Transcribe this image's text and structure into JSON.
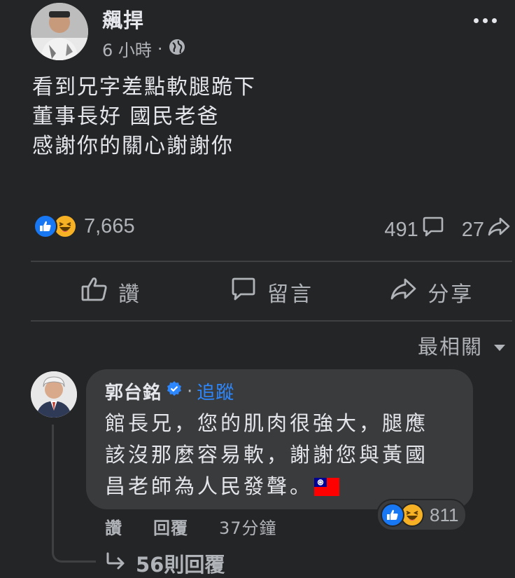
{
  "post": {
    "author": "飆捍",
    "time": "6 小時",
    "separator": "·",
    "privacy_icon": "globe-icon",
    "lines": [
      "看到兄字差點軟腿跪下",
      "董事長好 國民老爸",
      "感謝你的關心謝謝你"
    ]
  },
  "reactions": {
    "icons": [
      "like-icon",
      "haha-icon"
    ],
    "count": "7,665",
    "comments": "491",
    "shares": "27"
  },
  "actions": {
    "like": "讚",
    "comment": "留言",
    "share": "分享"
  },
  "sort": {
    "label": "最相關"
  },
  "comment": {
    "name": "郭台銘",
    "verified_icon": "verified-badge-icon",
    "dot": "·",
    "follow": "追蹤",
    "lines": [
      "館長兄，您的肌肉很強大，腿應",
      "該沒那麼容易軟，謝謝您與黃國",
      "昌老師為人民發聲。"
    ],
    "flag_icon": "taiwan-flag-icon",
    "reaction_count": "811",
    "like": "讚",
    "reply": "回覆",
    "time": "37分鐘",
    "view_replies": "56則回覆"
  },
  "colors": {
    "background": "#242526",
    "bubble": "#3a3b3c",
    "text": "#e4e6eb",
    "secondary": "#b0b3b8",
    "link": "#2d88ff",
    "like": "#1877f2",
    "haha": "#f7b125"
  }
}
